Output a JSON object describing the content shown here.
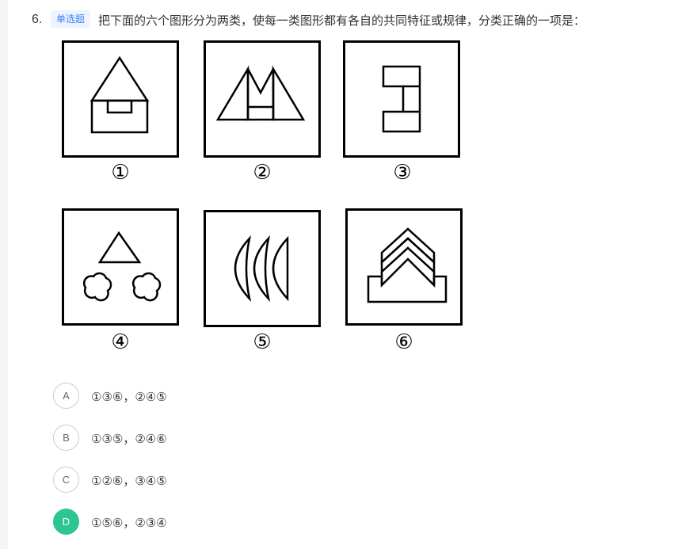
{
  "question": {
    "number": "6.",
    "type_tag": "单选题",
    "text": "把下面的六个图形分为两类，使每一类图形都有各自的共同特征或规律，分类正确的一项是："
  },
  "figures": [
    {
      "label": "①",
      "icon": "house-icon"
    },
    {
      "label": "②",
      "icon": "m-shape-icon"
    },
    {
      "label": "③",
      "icon": "bracket-shape-icon"
    },
    {
      "label": "④",
      "icon": "triangle-clouds-icon"
    },
    {
      "label": "⑤",
      "icon": "crescents-icon"
    },
    {
      "label": "⑥",
      "icon": "chevrons-tray-icon"
    }
  ],
  "options": [
    {
      "letter": "A",
      "text": "①③⑥，②④⑤",
      "selected": false
    },
    {
      "letter": "B",
      "text": "①③⑤，②④⑥",
      "selected": false
    },
    {
      "letter": "C",
      "text": "①②⑥，③④⑤",
      "selected": false
    },
    {
      "letter": "D",
      "text": "①⑤⑥，②③④",
      "selected": true
    }
  ],
  "colors": {
    "tag_bg": "#eef4ff",
    "tag_text": "#3b82f6",
    "selected": "#2ec590"
  }
}
